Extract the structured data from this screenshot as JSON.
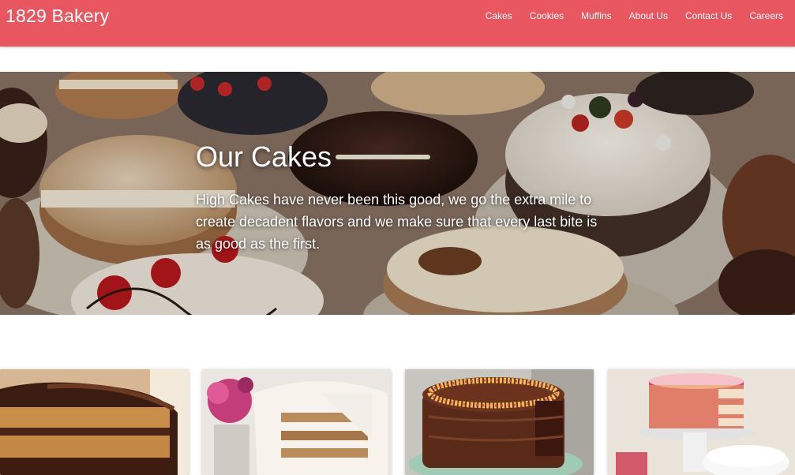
{
  "navbar": {
    "brand": "1829 Bakery",
    "links": [
      "Cakes",
      "Cookies",
      "Muffins",
      "About Us",
      "Contact Us",
      "Careers"
    ]
  },
  "hero": {
    "title": "Our Cakes",
    "description": "High Cakes have never been this good, we go the extra mile to create decadent flavors and we make sure that every last bite is as good as the first.",
    "image": "assorted-cakes-photo"
  },
  "cards": [
    {
      "image": "chocolate-layer-cake-photo"
    },
    {
      "image": "carrot-cake-cream-frosting-photo"
    },
    {
      "image": "chocolate-sprinkle-cake-photo"
    },
    {
      "image": "rainbow-sprinkle-cake-photo"
    }
  ],
  "colors": {
    "navbar_bg": "#e8565f",
    "nav_text": "#ffffff",
    "page_bg": "#ffffff"
  }
}
